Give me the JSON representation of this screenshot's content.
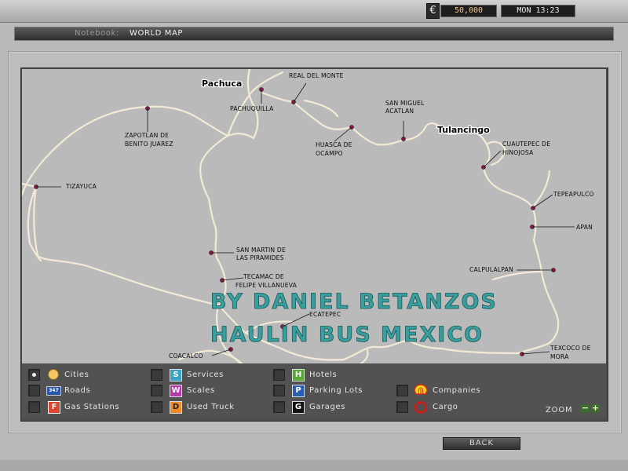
{
  "hud": {
    "currency_icon": "euro-icon",
    "currency_symbol": "€",
    "money": "50,000",
    "clock": "MON 13:23"
  },
  "header": {
    "notebook_label": "Notebook:",
    "title": "WORLD MAP"
  },
  "map": {
    "major_cities": [
      "Pachuca",
      "Tulancingo"
    ],
    "locations": [
      "REAL DEL MONTE",
      "PACHUQUILLA",
      "SAN MIGUEL",
      "ACATLAN",
      "ZAPOTLAN DE",
      "BENITO JUAREZ",
      "HUASCA DE",
      "OCAMPO",
      "CUAUTEPEC DE",
      "HINOJOSA",
      "TIZAYUCA",
      "TEPEAPULCO",
      "APAN",
      "SAN MARTIN DE",
      "LAS PIRAMIDES",
      "CALPULALPAN",
      "TECAMAC DE",
      "FELIPE VILLANUEVA",
      "ECATEPEC",
      "COACALCO",
      "TEXCOCO DE",
      "MORA"
    ],
    "watermark_line1": "BY DANIEL BETANZOS",
    "watermark_line2": "HAULIN BUS MEXICO"
  },
  "legend": {
    "items": [
      {
        "label": "Cities",
        "icon": "city-dot-icon",
        "checked": true
      },
      {
        "label": "Roads",
        "icon": "road-sign-icon",
        "icon_text": "347",
        "checked": false
      },
      {
        "label": "Gas Stations",
        "icon": "gas-station-icon",
        "icon_text": "F",
        "checked": false
      },
      {
        "label": "Services",
        "icon": "services-icon",
        "icon_text": "S",
        "checked": false
      },
      {
        "label": "Scales",
        "icon": "scales-icon",
        "icon_text": "W",
        "checked": false
      },
      {
        "label": "Used Truck",
        "icon": "used-truck-icon",
        "icon_text": "D",
        "checked": false
      },
      {
        "label": "Hotels",
        "icon": "hotel-icon",
        "icon_text": "H",
        "checked": false
      },
      {
        "label": "Parking Lots",
        "icon": "parking-icon",
        "icon_text": "P",
        "checked": false
      },
      {
        "label": "Garages",
        "icon": "garage-icon",
        "icon_text": "G",
        "checked": false
      },
      {
        "label": "Companies",
        "icon": "shell-logo-icon",
        "checked": false
      },
      {
        "label": "Cargo",
        "icon": "cargo-ring-icon",
        "checked": false
      }
    ],
    "zoom_label": "ZOOM",
    "zoom_out": "−",
    "zoom_in": "+"
  },
  "footer": {
    "back_label": "BACK"
  },
  "colors": {
    "road": "#f2ead6",
    "city_marker": "#a0134f",
    "watermark": "#2f9c9c"
  }
}
